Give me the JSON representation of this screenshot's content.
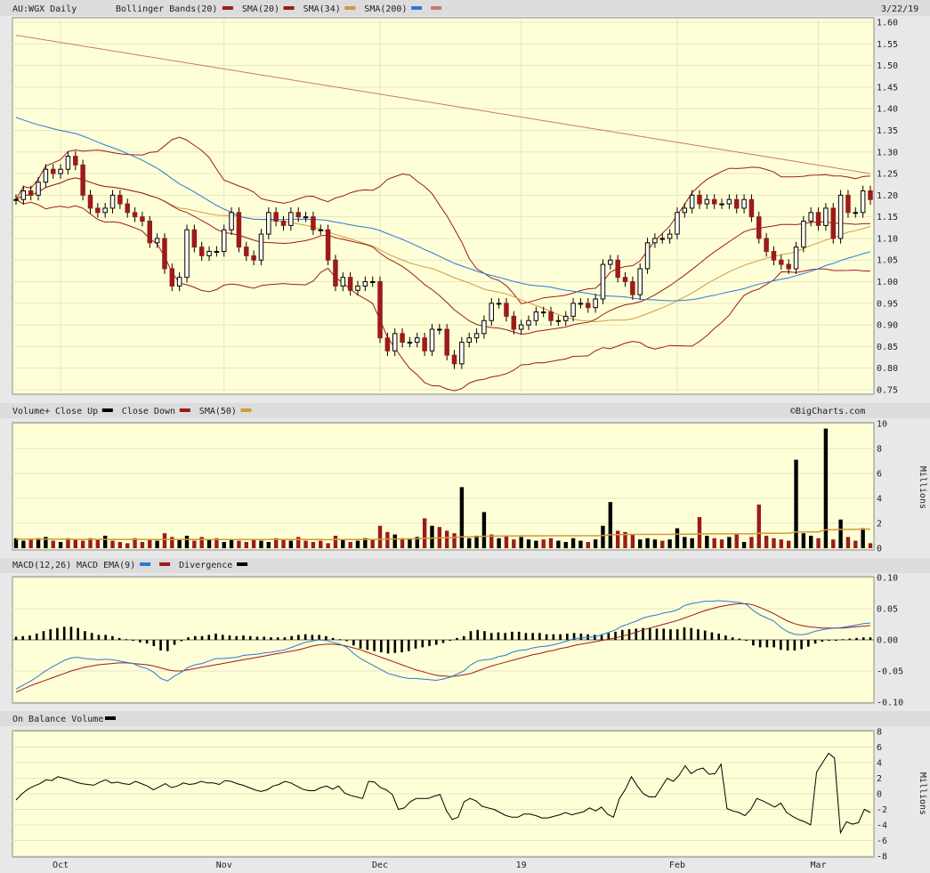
{
  "chart_data": [
    {
      "type": "candlestick",
      "panel": "price",
      "title": "AU:WGX Daily",
      "date": "3/22/19",
      "legend": [
        {
          "name": "Bollinger Bands(20)",
          "color": "#9b1b1b"
        },
        {
          "name": "SMA(20)",
          "color": "#9b1b1b"
        },
        {
          "name": "SMA(34)",
          "color": "#d19a3a"
        },
        {
          "name": "SMA(200)",
          "color": "#2a78d8"
        },
        {
          "name": "",
          "color": "#c87878"
        }
      ],
      "ylim": [
        0.75,
        1.6
      ],
      "yticks": [
        "1.60",
        "1.55",
        "1.50",
        "1.45",
        "1.40",
        "1.35",
        "1.30",
        "1.25",
        "1.20",
        "1.15",
        "1.10",
        "1.05",
        "1.00",
        "0.95",
        "0.90",
        "0.85",
        "0.80",
        "0.75"
      ],
      "up_color": "#ffffff",
      "down_color": "#9b1b1b",
      "close": [
        1.19,
        1.21,
        1.2,
        1.23,
        1.26,
        1.25,
        1.26,
        1.29,
        1.27,
        1.2,
        1.17,
        1.16,
        1.17,
        1.2,
        1.18,
        1.16,
        1.15,
        1.14,
        1.09,
        1.1,
        1.03,
        0.99,
        1.01,
        1.12,
        1.08,
        1.06,
        1.07,
        1.07,
        1.12,
        1.16,
        1.08,
        1.06,
        1.05,
        1.11,
        1.16,
        1.14,
        1.13,
        1.16,
        1.15,
        1.15,
        1.12,
        1.12,
        1.05,
        0.99,
        1.01,
        0.98,
        0.99,
        1.0,
        1.0,
        0.87,
        0.84,
        0.88,
        0.86,
        0.86,
        0.87,
        0.84,
        0.89,
        0.89,
        0.83,
        0.81,
        0.86,
        0.87,
        0.88,
        0.91,
        0.95,
        0.95,
        0.92,
        0.89,
        0.9,
        0.91,
        0.93,
        0.93,
        0.91,
        0.91,
        0.92,
        0.95,
        0.95,
        0.94,
        0.96,
        1.04,
        1.05,
        1.01,
        1.0,
        0.97,
        1.03,
        1.09,
        1.1,
        1.1,
        1.11,
        1.16,
        1.17,
        1.2,
        1.18,
        1.19,
        1.18,
        1.18,
        1.19,
        1.17,
        1.19,
        1.15,
        1.1,
        1.07,
        1.05,
        1.04,
        1.03,
        1.08,
        1.14,
        1.16,
        1.13,
        1.17,
        1.1,
        1.2,
        1.16,
        1.16,
        1.21,
        1.19
      ]
    },
    {
      "type": "bar",
      "panel": "volume",
      "title": "Volume+",
      "legend": [
        {
          "name": "Close Up",
          "color": "#000000"
        },
        {
          "name": "Close Down",
          "color": "#9b1b1b"
        },
        {
          "name": "SMA(50)",
          "color": "#d19a3a"
        }
      ],
      "ylabel": "Millions",
      "ylim": [
        0,
        10
      ],
      "yticks": [
        "10",
        "8",
        "6",
        "4",
        "2",
        "0"
      ],
      "watermark": "©BigCharts.com",
      "values": [
        0.8,
        0.6,
        0.7,
        0.8,
        0.9,
        0.6,
        0.5,
        0.8,
        0.7,
        0.6,
        0.8,
        0.7,
        1.0,
        0.6,
        0.5,
        0.4,
        0.8,
        0.5,
        0.7,
        0.6,
        1.2,
        0.9,
        0.7,
        1.0,
        0.6,
        0.9,
        0.7,
        0.8,
        0.5,
        0.7,
        0.6,
        0.5,
        0.7,
        0.6,
        0.5,
        0.8,
        0.7,
        0.6,
        0.9,
        0.6,
        0.5,
        0.6,
        0.4,
        1.0,
        0.7,
        0.5,
        0.6,
        0.8,
        0.7,
        1.8,
        1.3,
        1.1,
        0.8,
        0.7,
        0.9,
        2.4,
        1.8,
        1.7,
        1.4,
        1.2,
        4.9,
        0.8,
        1.0,
        2.9,
        1.1,
        0.8,
        1.0,
        0.7,
        0.9,
        0.7,
        0.6,
        0.7,
        0.8,
        0.6,
        0.5,
        0.8,
        0.6,
        0.5,
        0.7,
        1.8,
        3.7,
        1.4,
        1.3,
        1.1,
        0.7,
        0.8,
        0.7,
        0.6,
        0.7,
        1.6,
        0.9,
        0.8,
        2.5,
        1.0,
        0.8,
        0.7,
        0.9,
        1.1,
        0.5,
        0.9,
        3.5,
        1.0,
        0.8,
        0.7,
        0.6,
        7.1,
        1.2,
        1.0,
        0.8,
        9.6,
        0.7,
        2.3,
        0.9,
        0.6,
        1.6,
        0.4
      ],
      "directions": [
        "u",
        "u",
        "d",
        "u",
        "u",
        "d",
        "u",
        "d",
        "d",
        "d",
        "d",
        "d",
        "u",
        "d",
        "d",
        "d",
        "d",
        "d",
        "d",
        "u",
        "d",
        "d",
        "u",
        "u",
        "d",
        "d",
        "u",
        "d",
        "u",
        "u",
        "d",
        "d",
        "d",
        "u",
        "u",
        "d",
        "d",
        "u",
        "d",
        "d",
        "d",
        "d",
        "d",
        "d",
        "u",
        "d",
        "u",
        "u",
        "d",
        "d",
        "d",
        "u",
        "d",
        "u",
        "u",
        "d",
        "u",
        "d",
        "d",
        "d",
        "u",
        "u",
        "u",
        "u",
        "d",
        "u",
        "d",
        "d",
        "u",
        "u",
        "u",
        "d",
        "d",
        "u",
        "u",
        "u",
        "u",
        "d",
        "u",
        "u",
        "u",
        "d",
        "d",
        "d",
        "u",
        "u",
        "u",
        "d",
        "u",
        "u",
        "u",
        "u",
        "d",
        "u",
        "d",
        "d",
        "u",
        "d",
        "u",
        "d",
        "d",
        "d",
        "d",
        "d",
        "d",
        "u",
        "u",
        "u",
        "d",
        "u",
        "d",
        "u",
        "d",
        "d",
        "u",
        "d"
      ],
      "sma50": [
        0.72,
        0.72,
        0.72,
        0.72,
        0.72,
        0.72,
        0.72,
        0.72,
        0.71,
        0.71,
        0.71,
        0.71,
        0.71,
        0.71,
        0.71,
        0.7,
        0.7,
        0.7,
        0.7,
        0.7,
        0.7,
        0.7,
        0.7,
        0.7,
        0.7,
        0.7,
        0.7,
        0.7,
        0.7,
        0.7,
        0.7,
        0.69,
        0.69,
        0.69,
        0.69,
        0.69,
        0.69,
        0.69,
        0.69,
        0.69,
        0.69,
        0.69,
        0.68,
        0.69,
        0.69,
        0.69,
        0.69,
        0.69,
        0.7,
        0.72,
        0.73,
        0.74,
        0.74,
        0.75,
        0.76,
        0.79,
        0.81,
        0.83,
        0.85,
        0.86,
        0.91,
        0.91,
        0.92,
        0.96,
        0.97,
        0.97,
        0.98,
        0.98,
        0.99,
        0.99,
        0.99,
        0.99,
        1.0,
        1.0,
        1.0,
        1.0,
        1.0,
        1.0,
        1.0,
        1.02,
        1.08,
        1.09,
        1.1,
        1.11,
        1.11,
        1.11,
        1.11,
        1.11,
        1.11,
        1.12,
        1.12,
        1.12,
        1.15,
        1.15,
        1.15,
        1.15,
        1.15,
        1.15,
        1.15,
        1.15,
        1.19,
        1.19,
        1.19,
        1.19,
        1.19,
        1.3,
        1.31,
        1.31,
        1.31,
        1.48,
        1.48,
        1.51,
        1.51,
        1.51,
        1.53,
        1.53
      ]
    },
    {
      "type": "line",
      "panel": "macd",
      "title": "MACD(12,26)",
      "legend": [
        {
          "name": "MACD EMA(9)",
          "color": "#2a78d8"
        },
        {
          "name": "",
          "color": "#9b1b1b"
        },
        {
          "name": "Divergence",
          "color": "#000000"
        }
      ],
      "ylim": [
        -0.1,
        0.1
      ],
      "yticks": [
        "0.10",
        "0.05",
        "0.00",
        "-0.05",
        "-0.10"
      ],
      "macd": [
        -0.079,
        -0.073,
        -0.067,
        -0.06,
        -0.052,
        -0.045,
        -0.039,
        -0.033,
        -0.029,
        -0.028,
        -0.03,
        -0.031,
        -0.032,
        -0.031,
        -0.032,
        -0.034,
        -0.036,
        -0.038,
        -0.043,
        -0.046,
        -0.052,
        -0.062,
        -0.066,
        -0.058,
        -0.052,
        -0.044,
        -0.04,
        -0.038,
        -0.034,
        -0.03,
        -0.03,
        -0.029,
        -0.028,
        -0.025,
        -0.024,
        -0.023,
        -0.021,
        -0.02,
        -0.018,
        -0.016,
        -0.012,
        -0.008,
        -0.004,
        -0.002,
        0.0,
        -0.001,
        -0.004,
        -0.007,
        -0.012,
        -0.022,
        -0.03,
        -0.036,
        -0.042,
        -0.048,
        -0.054,
        -0.057,
        -0.06,
        -0.062,
        -0.062,
        -0.063,
        -0.064,
        -0.065,
        -0.063,
        -0.06,
        -0.055,
        -0.05,
        -0.04,
        -0.034,
        -0.032,
        -0.031,
        -0.027,
        -0.025,
        -0.02,
        -0.017,
        -0.016,
        -0.013,
        -0.011,
        -0.01,
        -0.008,
        -0.005,
        -0.002,
        0.002,
        0.003,
        0.004,
        0.005,
        0.008,
        0.012,
        0.016,
        0.022,
        0.026,
        0.03,
        0.035,
        0.038,
        0.04,
        0.043,
        0.045,
        0.048,
        0.055,
        0.058,
        0.06,
        0.062,
        0.062,
        0.063,
        0.062,
        0.061,
        0.06,
        0.057,
        0.047,
        0.04,
        0.035,
        0.03,
        0.02,
        0.013,
        0.009,
        0.008,
        0.01,
        0.014,
        0.016,
        0.018,
        0.019,
        0.02,
        0.022,
        0.024,
        0.026,
        0.027
      ],
      "signal": [
        -0.084,
        -0.079,
        -0.074,
        -0.07,
        -0.066,
        -0.062,
        -0.058,
        -0.054,
        -0.05,
        -0.047,
        -0.044,
        -0.042,
        -0.04,
        -0.039,
        -0.038,
        -0.037,
        -0.037,
        -0.038,
        -0.039,
        -0.04,
        -0.042,
        -0.045,
        -0.048,
        -0.05,
        -0.05,
        -0.048,
        -0.046,
        -0.044,
        -0.042,
        -0.04,
        -0.038,
        -0.036,
        -0.034,
        -0.032,
        -0.03,
        -0.028,
        -0.026,
        -0.024,
        -0.022,
        -0.02,
        -0.018,
        -0.016,
        -0.013,
        -0.01,
        -0.008,
        -0.007,
        -0.007,
        -0.008,
        -0.01,
        -0.013,
        -0.016,
        -0.02,
        -0.024,
        -0.028,
        -0.032,
        -0.036,
        -0.04,
        -0.044,
        -0.048,
        -0.051,
        -0.054,
        -0.057,
        -0.058,
        -0.059,
        -0.058,
        -0.056,
        -0.054,
        -0.05,
        -0.046,
        -0.042,
        -0.039,
        -0.036,
        -0.033,
        -0.03,
        -0.027,
        -0.024,
        -0.022,
        -0.019,
        -0.017,
        -0.014,
        -0.012,
        -0.009,
        -0.007,
        -0.005,
        -0.003,
        -0.001,
        0.001,
        0.003,
        0.006,
        0.009,
        0.012,
        0.016,
        0.019,
        0.022,
        0.025,
        0.028,
        0.031,
        0.035,
        0.039,
        0.043,
        0.047,
        0.05,
        0.053,
        0.055,
        0.057,
        0.058,
        0.058,
        0.056,
        0.052,
        0.047,
        0.042,
        0.036,
        0.03,
        0.026,
        0.023,
        0.021,
        0.02,
        0.019,
        0.019,
        0.019,
        0.019,
        0.02,
        0.021,
        0.022,
        0.023
      ],
      "divergence": [
        0.005,
        0.006,
        0.007,
        0.01,
        0.014,
        0.017,
        0.019,
        0.021,
        0.021,
        0.019,
        0.014,
        0.011,
        0.008,
        0.008,
        0.006,
        0.003,
        0.001,
        0.0,
        -0.004,
        -0.006,
        -0.01,
        -0.017,
        -0.018,
        -0.008,
        -0.002,
        0.004,
        0.006,
        0.006,
        0.008,
        0.01,
        0.008,
        0.007,
        0.006,
        0.007,
        0.006,
        0.005,
        0.005,
        0.004,
        0.004,
        0.004,
        0.006,
        0.008,
        0.009,
        0.008,
        0.008,
        0.006,
        0.003,
        0.001,
        -0.002,
        -0.009,
        -0.014,
        -0.016,
        -0.018,
        -0.02,
        -0.022,
        -0.021,
        -0.02,
        -0.018,
        -0.014,
        -0.012,
        -0.01,
        -0.008,
        -0.005,
        -0.001,
        0.003,
        0.006,
        0.014,
        0.016,
        0.014,
        0.011,
        0.012,
        0.011,
        0.013,
        0.013,
        0.011,
        0.011,
        0.011,
        0.009,
        0.009,
        0.009,
        0.01,
        0.011,
        0.01,
        0.009,
        0.008,
        0.009,
        0.011,
        0.013,
        0.016,
        0.017,
        0.018,
        0.019,
        0.019,
        0.018,
        0.018,
        0.017,
        0.017,
        0.02,
        0.019,
        0.017,
        0.015,
        0.012,
        0.01,
        0.007,
        0.004,
        0.002,
        -0.001,
        -0.009,
        -0.012,
        -0.012,
        -0.012,
        -0.016,
        -0.017,
        -0.017,
        -0.015,
        -0.011,
        -0.006,
        -0.003,
        -0.001,
        0.0,
        0.001,
        0.002,
        0.003,
        0.004,
        0.004
      ]
    },
    {
      "type": "line",
      "panel": "obv",
      "title": "On Balance Volume",
      "legend": [
        {
          "name": "",
          "color": "#000000"
        }
      ],
      "ylabel": "Millions",
      "ylim": [
        -8,
        8
      ],
      "yticks": [
        "8",
        "6",
        "4",
        "2",
        "0",
        "-2",
        "-4",
        "-6",
        "-8"
      ],
      "xticks": [
        {
          "label": "Oct",
          "index": 6
        },
        {
          "label": "Nov",
          "index": 28
        },
        {
          "label": "Dec",
          "index": 49
        },
        {
          "label": "19",
          "index": 68
        },
        {
          "label": "Feb",
          "index": 89
        },
        {
          "label": "Mar",
          "index": 108
        }
      ],
      "values": [
        -0.8,
        0.0,
        0.6,
        1.0,
        1.3,
        1.8,
        1.7,
        2.2,
        2.0,
        1.8,
        1.5,
        1.3,
        1.2,
        1.1,
        1.5,
        1.8,
        1.4,
        1.5,
        1.3,
        1.2,
        1.6,
        1.3,
        1.0,
        0.5,
        0.9,
        1.3,
        0.8,
        1.0,
        1.4,
        1.2,
        1.3,
        1.6,
        1.4,
        1.4,
        1.2,
        1.7,
        1.6,
        1.3,
        1.1,
        0.8,
        0.5,
        0.3,
        0.5,
        1.0,
        1.2,
        1.6,
        1.4,
        1.0,
        0.6,
        0.4,
        0.4,
        0.8,
        1.0,
        0.6,
        1.0,
        0.1,
        -0.2,
        -0.4,
        -0.6,
        1.6,
        1.5,
        0.8,
        0.5,
        -0.1,
        -2.0,
        -1.8,
        -1.0,
        -0.6,
        -0.6,
        -0.6,
        -0.3,
        -0.1,
        -2.1,
        -3.3,
        -3.0,
        -1.0,
        -0.6,
        -0.9,
        -1.6,
        -1.8,
        -2.0,
        -2.4,
        -2.8,
        -3.0,
        -3.0,
        -2.6,
        -2.6,
        -2.8,
        -3.1,
        -3.1,
        -2.9,
        -2.7,
        -2.4,
        -2.7,
        -2.5,
        -2.3,
        -1.8,
        -2.2,
        -1.7,
        -2.6,
        -3.0,
        -0.6,
        0.6,
        2.2,
        1.0,
        0.0,
        -0.4,
        -0.4,
        0.8,
        2.0,
        1.6,
        2.4,
        3.6,
        2.6,
        3.1,
        3.3,
        2.5,
        2.6,
        3.8,
        -1.9,
        -2.2,
        -2.4,
        -2.8,
        -2.0,
        -0.6,
        -0.9,
        -1.3,
        -1.7,
        -1.2,
        -2.4,
        -2.9,
        -3.3,
        -3.6,
        -4.0,
        2.8,
        4.0,
        5.2,
        4.6,
        -5.0,
        -3.6,
        -3.9,
        -3.7,
        -2.0,
        -2.4
      ]
    }
  ]
}
